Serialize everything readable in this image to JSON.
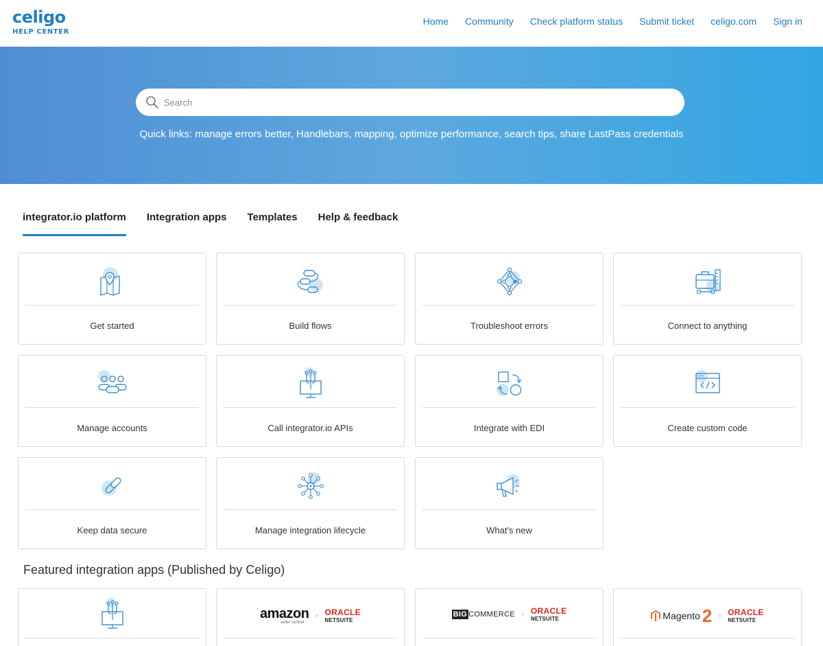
{
  "header": {
    "logo_word": "celigo",
    "logo_sub": "HELP CENTER",
    "nav": [
      "Home",
      "Community",
      "Check platform status",
      "Submit ticket",
      "celigo.com",
      "Sign in"
    ]
  },
  "hero": {
    "search_placeholder": "Search",
    "quicklinks_prefix": "Quick links: ",
    "quicklinks": [
      "manage errors better",
      "Handlebars",
      "mapping",
      "optimize performance",
      "search tips",
      "share LastPass credentials"
    ],
    "quicklinks_separator": ", "
  },
  "tabs": [
    {
      "label": "integrator.io platform",
      "active": true
    },
    {
      "label": "Integration apps",
      "active": false
    },
    {
      "label": "Templates",
      "active": false
    },
    {
      "label": "Help & feedback",
      "active": false
    }
  ],
  "cards": [
    {
      "label": "Get started",
      "icon": "map-pin-icon"
    },
    {
      "label": "Build flows",
      "icon": "flow-icon"
    },
    {
      "label": "Troubleshoot errors",
      "icon": "network-icon"
    },
    {
      "label": "Connect to anything",
      "icon": "toolbox-icon"
    },
    {
      "label": "Manage accounts",
      "icon": "users-icon"
    },
    {
      "label": "Call integrator.io APIs",
      "icon": "api-monitor-icon"
    },
    {
      "label": "Integrate with EDI",
      "icon": "edi-exchange-icon"
    },
    {
      "label": "Create custom code",
      "icon": "code-window-icon"
    },
    {
      "label": "Keep data secure",
      "icon": "link-icon"
    },
    {
      "label": "Manage integration lifecycle",
      "icon": "lifecycle-icon"
    },
    {
      "label": "What's new",
      "icon": "megaphone-icon"
    }
  ],
  "featured": {
    "title": "Featured integration apps (Published by Celigo)",
    "apps": [
      {
        "name": "integration-app-icon"
      },
      {
        "brand": "amazon",
        "brand_sub": "seller central",
        "partner": "ORACLE",
        "partner_sub": "NETSUITE"
      },
      {
        "brand_b": "BIG",
        "brand": "COMMERCE",
        "partner": "ORACLE",
        "partner_sub": "NETSUITE"
      },
      {
        "brand": "Magento",
        "brand_num": "2",
        "partner": "ORACLE",
        "partner_sub": "NETSUITE"
      }
    ]
  },
  "colors": {
    "brand_blue": "#1e7fc3",
    "icon_blue": "#3a8fd0",
    "icon_bubble": "#cfe6f7",
    "oracle_red": "#e2231a",
    "magento_orange": "#ee672f"
  }
}
